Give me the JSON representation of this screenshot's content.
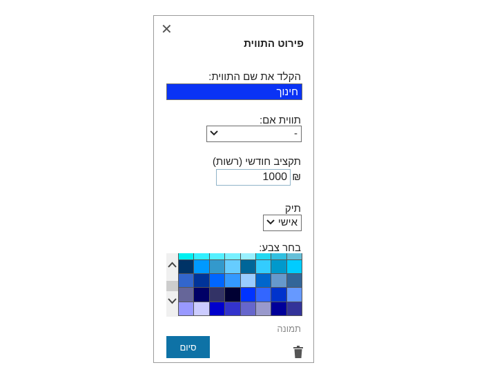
{
  "panel": {
    "title": "פירוט התווית",
    "close_icon": "close-icon",
    "name_label": "הקלד את שם התווית:",
    "name_value": "חינוך",
    "parent_label": "תווית אם:",
    "parent_value": "-",
    "budget_label": "תקציב חודשי (רשות)",
    "currency": "₪",
    "budget_value": "1000",
    "folder_label": "תיק",
    "folder_value": "אישי",
    "color_label": "בחר צבע:",
    "image_link": "תמונה",
    "done_button": "סיום",
    "trash_icon": "trash-icon",
    "accent_color": "#0a33f5",
    "button_color": "#0e72a6",
    "palette_top": [
      "#00f0f0",
      "#33f0ff",
      "#55f0ff",
      "#77f0ff",
      "#99f0ff",
      "#22d8f0",
      "#33c0e0",
      "#66c0d8"
    ],
    "palette": [
      [
        "#003366",
        "#0099ff",
        "#3399cc",
        "#66ccff",
        "#006699",
        "#33ccff",
        "#0099cc",
        "#00ccff"
      ],
      [
        "#3366cc",
        "#003399",
        "#0066ff",
        "#3399ff",
        "#99ccff",
        "#0066cc",
        "#6699cc",
        "#336699"
      ],
      [
        "#666699",
        "#000066",
        "#333366",
        "#000033",
        "#0033ff",
        "#3366ff",
        "#0033cc",
        "#6699ff"
      ],
      [
        "#9999ff",
        "#ccccff",
        "#0000cc",
        "#3333cc",
        "#6666cc",
        "#9999cc",
        "#000099",
        "#333399"
      ]
    ]
  }
}
